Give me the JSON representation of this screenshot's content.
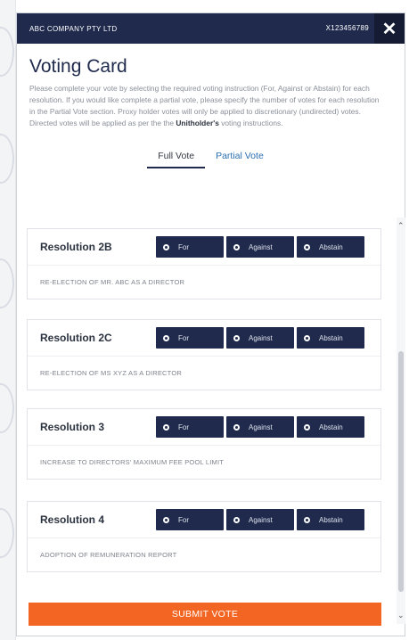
{
  "header": {
    "company": "ABC COMPANY PTY LTD",
    "reference": "X123456789",
    "close_symbol": "✕"
  },
  "title": "Voting Card",
  "instructions": {
    "part1": "Please complete your vote by selecting the required voting instruction (For, Against or Abstain) for each resolution. If you would like complete a partial vote, please specify the number of votes for each resolution in the Partial Vote section. Proxy holder votes will only be applied to discretionary (undirected) votes. Directed votes will be applied as per the the ",
    "bold": "Unitholder's",
    "part2": " voting instructions."
  },
  "tabs": [
    {
      "label": "Full Vote",
      "active": true
    },
    {
      "label": "Partial Vote",
      "active": false
    }
  ],
  "vote_options": [
    "For",
    "Against",
    "Abstain"
  ],
  "resolutions": [
    {
      "title": "Resolution 2B",
      "description": "RE-ELECTION OF MR. ABC AS A DIRECTOR"
    },
    {
      "title": "Resolution 2C",
      "description": "RE-ELECTION OF MS XYZ AS A DIRECTOR"
    },
    {
      "title": "Resolution 3",
      "description": "INCREASE TO DIRECTORS' MAXIMUM FEE POOL LIMIT"
    },
    {
      "title": "Resolution 4",
      "description": "ADOPTION OF REMUNERATION REPORT"
    }
  ],
  "submit_label": "SUBMIT VOTE",
  "colors": {
    "navy": "#1f2a4d",
    "orange": "#f26522",
    "link_blue": "#2a6fb0"
  }
}
